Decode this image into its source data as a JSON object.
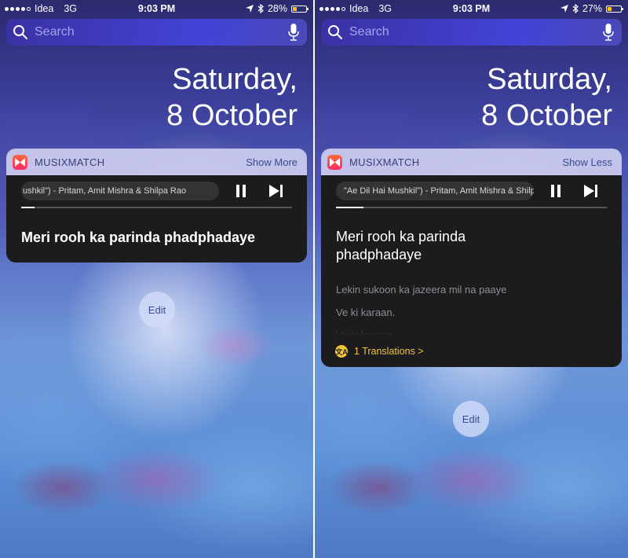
{
  "screens": [
    {
      "status": {
        "carrier": "Idea",
        "network": "3G",
        "time": "9:03 PM",
        "battery": "28%",
        "battery_level": 0.28,
        "signal_bars_filled": 4,
        "signal_bars_total": 5
      },
      "search": {
        "placeholder": "Search"
      },
      "date": {
        "line1": "Saturday,",
        "line2": "8 October"
      },
      "widget": {
        "app_name": "MUSIXMATCH",
        "toggle_label": "Show More",
        "track": "ushkil\") - Pritam, Amit Mishra & Shilpa Rao",
        "progress": 0.05,
        "current_lyric": "Meri rooh ka parinda phadphadaye"
      },
      "edit_label": "Edit"
    },
    {
      "status": {
        "carrier": "Idea",
        "network": "3G",
        "time": "9:03 PM",
        "battery": "27%",
        "battery_level": 0.27,
        "signal_bars_filled": 4,
        "signal_bars_total": 5
      },
      "search": {
        "placeholder": "Search"
      },
      "date": {
        "line1": "Saturday,",
        "line2": "8 October"
      },
      "widget": {
        "app_name": "MUSIXMATCH",
        "toggle_label": "Show Less",
        "track": "\"Ae Dil Hai Mushkil\") - Pritam, Amit Mishra & Shilpa Rao",
        "progress": 0.1,
        "current_lyric": "Meri rooh ka parinda phadphadaye",
        "next_lyrics": [
          "Lekin sukoon ka jazeera mil na paaye",
          "Ve ki karaan.",
          "Ve ki karaan."
        ],
        "translations_label": "1 Translations >",
        "translate_icon_glyph": "文A"
      },
      "edit_label": "Edit"
    }
  ],
  "colors": {
    "accent_yellow": "#f0c43a",
    "widget_dark": "#1c1c1e",
    "header_tint": "#cdcdf0",
    "brand_gradient": [
      "#ff6a3d",
      "#ff2a68"
    ]
  }
}
